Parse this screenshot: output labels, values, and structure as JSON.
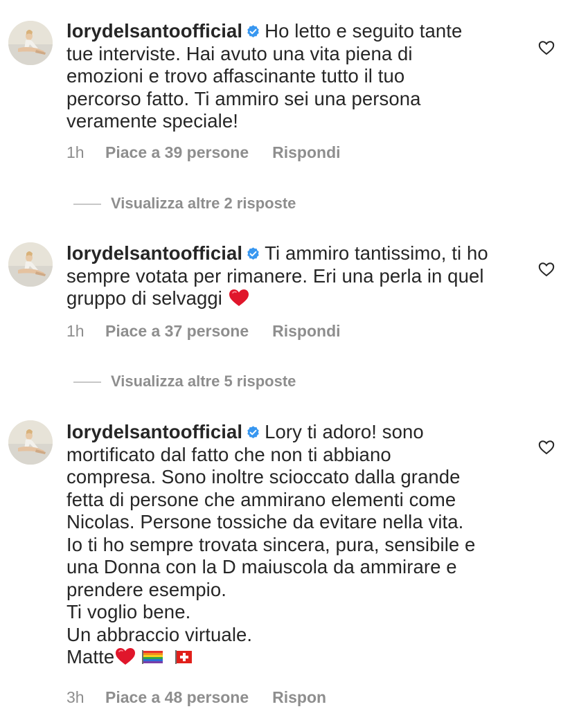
{
  "comments": [
    {
      "username": "lorydelsantoofficial",
      "lines": [
        "Ho letto e seguito tante",
        "tue interviste. Hai avuto una vita piena di",
        "emozioni e trovo affascinante tutto il tuo",
        "percorso fatto. Ti ammiro sei una persona",
        "veramente speciale!"
      ],
      "time": "1h",
      "likes": "Piace a 39 persone",
      "reply": "Rispondi",
      "view_replies": "Visualizza altre 2 risposte"
    },
    {
      "username": "lorydelsantoofficial",
      "lines": [
        "Ti ammiro tantissimo, ti ho",
        "sempre votata per rimanere. Eri una perla in quel",
        "gruppo di selvaggi"
      ],
      "time": "1h",
      "likes": "Piace a 37 persone",
      "reply": "Rispondi",
      "view_replies": "Visualizza altre 5 risposte"
    },
    {
      "username": "lorydelsantoofficial",
      "lines": [
        "Lory ti adoro! sono",
        "mortificato dal fatto che non ti abbiano",
        "compresa. Sono inoltre scioccato dalla grande",
        "fetta di persone che ammirano elementi come",
        "Nicolas. Persone tossiche da evitare nella vita.",
        "Io ti ho sempre trovata sincera, pura, sensibile e",
        "una Donna con la D maiuscola da ammirare e",
        "prendere esempio.",
        "Ti voglio bene.",
        "Un abbraccio virtuale.",
        "Matte"
      ],
      "time": "3h",
      "likes": "Piace a 48 persone",
      "reply": "Rispon"
    }
  ],
  "icons": {
    "verified": "verified-badge-icon",
    "like": "heart-outline-icon",
    "emoji_heart": "red-heart-emoji",
    "rainbow_flag": "rainbow-flag-emoji",
    "swiss_flag": "swiss-flag-emoji"
  },
  "colors": {
    "text": "#262626",
    "secondary": "#8e8e8e",
    "verified": "#3897f0",
    "emoji_heart": "#e0162b"
  }
}
